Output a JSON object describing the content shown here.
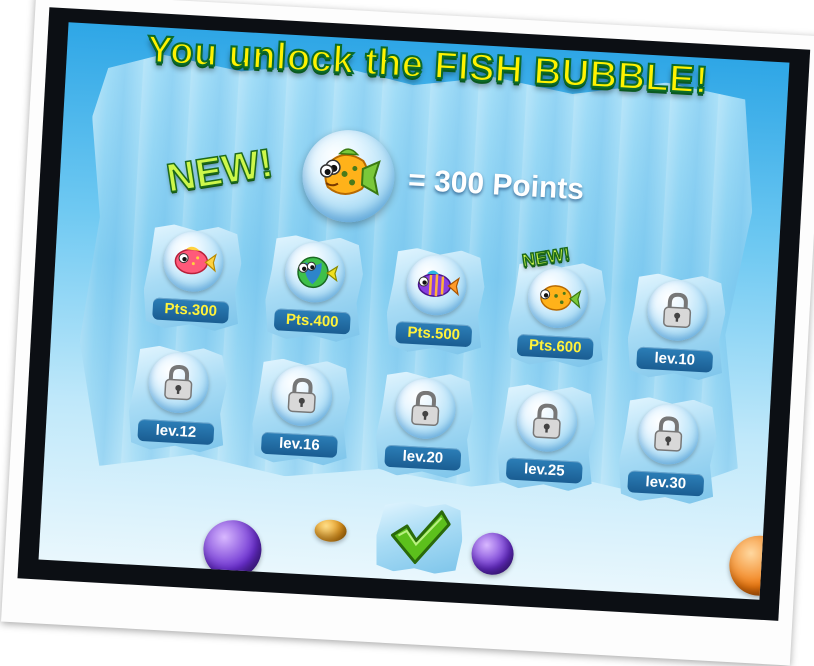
{
  "header": {
    "title": "You unlock the FISH BUBBLE!"
  },
  "reward": {
    "new_tag": "NEW!",
    "equals_text": "= 300 Points",
    "icon": "orange-spotted-fish-icon"
  },
  "tiles": [
    {
      "label": "Pts.300",
      "kind": "fish",
      "icon": "pink-fish-icon",
      "colors": [
        "#ff5a7a",
        "#ffd23f"
      ]
    },
    {
      "label": "Pts.400",
      "kind": "fish",
      "icon": "green-blue-fish-icon",
      "colors": [
        "#3ec04a",
        "#2a7ae0"
      ]
    },
    {
      "label": "Pts.500",
      "kind": "fish",
      "icon": "purple-striped-fish-icon",
      "colors": [
        "#8a3ee0",
        "#ff9a2a"
      ]
    },
    {
      "label": "Pts.600",
      "kind": "fish",
      "icon": "orange-spotted-fish-icon",
      "colors": [
        "#ffb21a",
        "#4a8a1a"
      ],
      "new_tag": "NEW!"
    },
    {
      "label": "lev.10",
      "kind": "lock",
      "icon": "padlock-icon"
    },
    {
      "label": "lev.12",
      "kind": "lock",
      "icon": "padlock-icon"
    },
    {
      "label": "lev.16",
      "kind": "lock",
      "icon": "padlock-icon"
    },
    {
      "label": "lev.20",
      "kind": "lock",
      "icon": "padlock-icon"
    },
    {
      "label": "lev.25",
      "kind": "lock",
      "icon": "padlock-icon"
    },
    {
      "label": "lev.30",
      "kind": "lock",
      "icon": "padlock-icon"
    }
  ],
  "confirm": {
    "icon": "checkmark-icon",
    "color": "#5cc01c"
  },
  "colors": {
    "title_yellow": "#fff200",
    "title_outline": "#0b6b2a",
    "points_yellow": "#fff23a",
    "label_blue": "#1a5d92"
  }
}
